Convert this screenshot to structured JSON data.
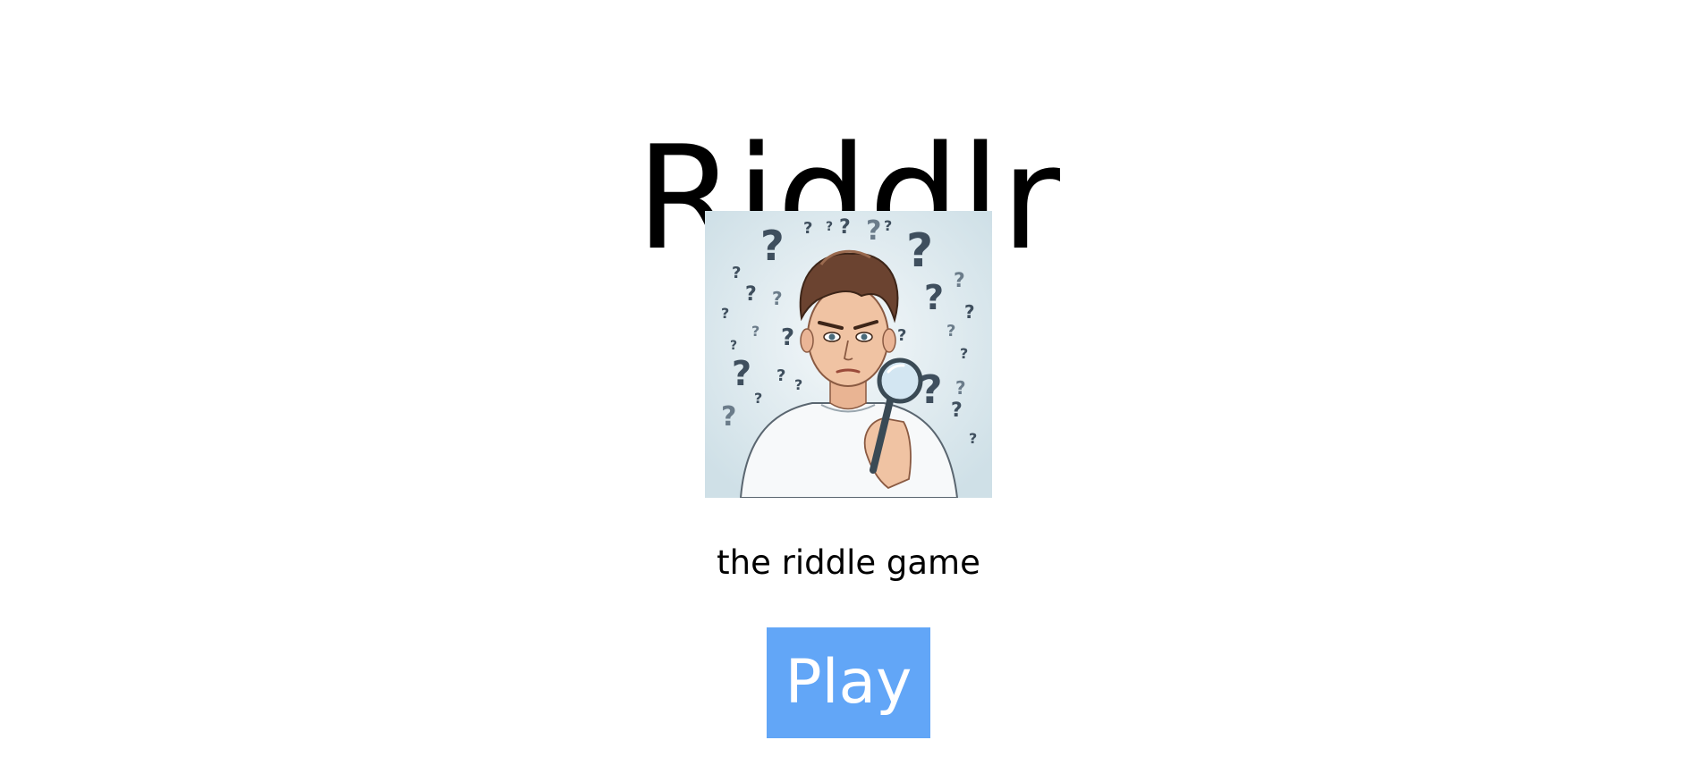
{
  "app": {
    "title": "Riddlr",
    "tagline": "the riddle game"
  },
  "hero_image": {
    "description_icon": "confused-person-with-magnifier-icon",
    "background_color": "#dbe8ee"
  },
  "actions": {
    "play_label": "Play",
    "play_color": "#62a6f7"
  }
}
